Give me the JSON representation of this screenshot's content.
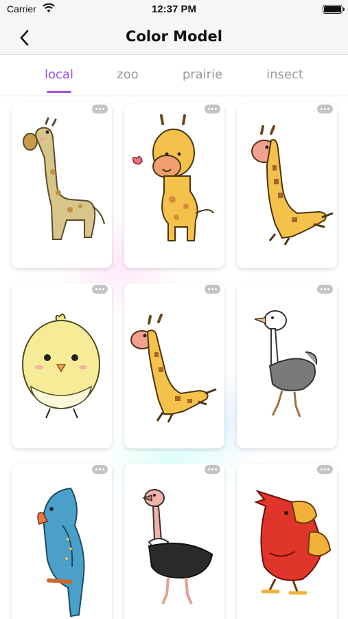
{
  "status_bar": {
    "carrier": "Carrier",
    "time": "12:37 PM"
  },
  "nav": {
    "title": "Color Model",
    "back_icon": "chevron-left-icon"
  },
  "tabs": [
    {
      "label": "local",
      "active": true
    },
    {
      "label": "zoo",
      "active": false
    },
    {
      "label": "prairie",
      "active": false
    },
    {
      "label": "insect",
      "active": false
    }
  ],
  "colors": {
    "accent": "#a44ee0",
    "inactive_tab": "#9a9a9a",
    "nav_background": "#f6f6f6"
  },
  "cards": [
    {
      "subject": "giraffe"
    },
    {
      "subject": "giraffe-with-butterfly"
    },
    {
      "subject": "leaping-giraffe"
    },
    {
      "subject": "chick"
    },
    {
      "subject": "leaping-giraffe"
    },
    {
      "subject": "ostrich"
    },
    {
      "subject": "parrot"
    },
    {
      "subject": "ostrich"
    },
    {
      "subject": "red-bird"
    }
  ]
}
